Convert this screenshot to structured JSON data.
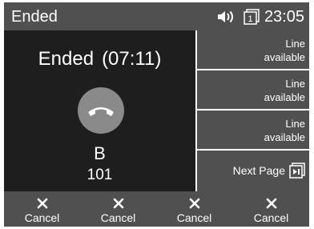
{
  "status_bar": {
    "title": "Ended",
    "time": "23:05",
    "line_indicator": "1",
    "icons": [
      "speaker-volume-icon",
      "line-indicator-icon"
    ]
  },
  "call": {
    "state": "Ended",
    "duration": "(07:11)",
    "contact_name": "B",
    "contact_number": "101",
    "hangup_icon": "handset-down-icon",
    "hangup_color": "#8a8a8a"
  },
  "line_keys": [
    {
      "line1": "Line",
      "line2": "available"
    },
    {
      "line1": "Line",
      "line2": "available"
    },
    {
      "line1": "Line",
      "line2": "available"
    }
  ],
  "next_page": {
    "label": "Next Page",
    "icon": "next-page-icon"
  },
  "soft_keys": [
    {
      "label": "Cancel",
      "icon": "close-icon"
    },
    {
      "label": "Cancel",
      "icon": "close-icon"
    },
    {
      "label": "Cancel",
      "icon": "close-icon"
    },
    {
      "label": "Cancel",
      "icon": "close-icon"
    }
  ],
  "colors": {
    "bar": "#505050",
    "background": "#1e1e1e",
    "text": "#ffffff"
  }
}
